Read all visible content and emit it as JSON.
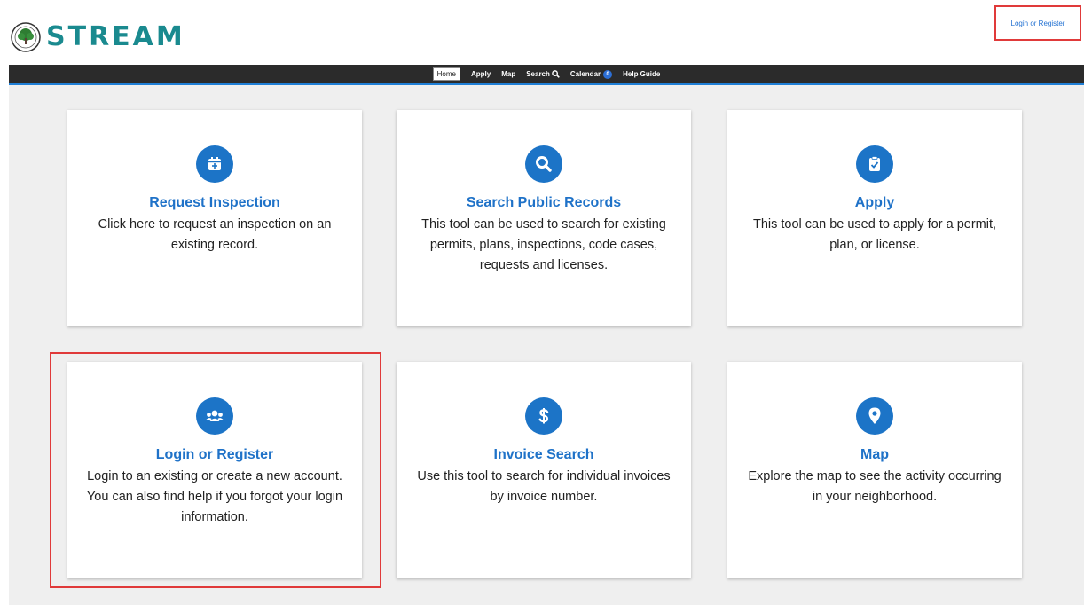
{
  "header": {
    "logo_text": "STREAM",
    "login_link": "Login or Register"
  },
  "nav": {
    "items": [
      {
        "label": "Home",
        "active": true
      },
      {
        "label": "Apply"
      },
      {
        "label": "Map"
      },
      {
        "label": "Search"
      },
      {
        "label": "Calendar",
        "badge": "0"
      },
      {
        "label": "Help Guide"
      }
    ]
  },
  "cards": [
    {
      "title": "Request Inspection",
      "desc": "Click here to request an inspection on an existing record.",
      "icon": "calendar-plus-icon"
    },
    {
      "title": "Search Public Records",
      "desc": "This tool can be used to search for existing permits, plans, inspections, code cases, requests and licenses.",
      "icon": "search-icon"
    },
    {
      "title": "Apply",
      "desc": "This tool can be used to apply for a permit, plan, or license.",
      "icon": "clipboard-check-icon"
    },
    {
      "title": "Login or Register",
      "desc": "Login to an existing or create a new account. You can also find help if you forgot your login information.",
      "icon": "users-icon"
    },
    {
      "title": "Invoice Search",
      "desc": "Use this tool to search for individual invoices by invoice number.",
      "icon": "dollar-icon"
    },
    {
      "title": "Map",
      "desc": "Explore the map to see the activity occurring in your neighborhood.",
      "icon": "map-pin-icon"
    }
  ],
  "colors": {
    "accent": "#1c74c7",
    "nav_bg": "#2b2b2b",
    "highlight": "#e03a3a",
    "logo": "#1a8a8f"
  }
}
